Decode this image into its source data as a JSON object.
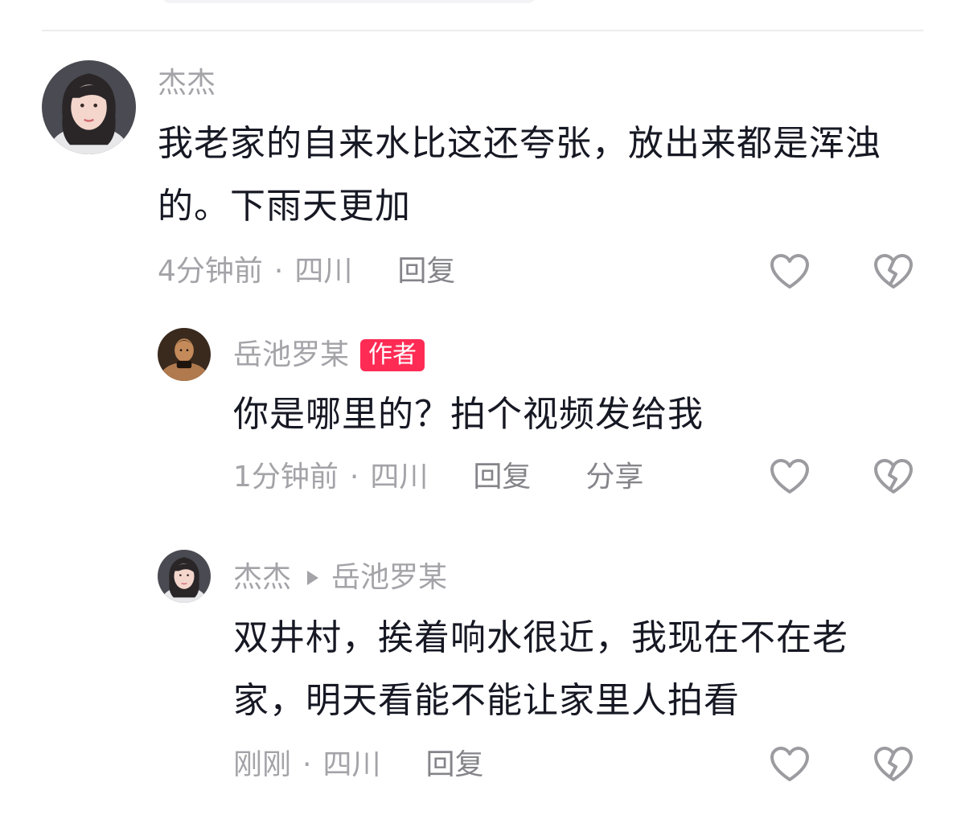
{
  "comments": [
    {
      "username": "杰杰",
      "text": "我老家的自来水比这还夸张，放出来都是浑浊的。下雨天更加",
      "time": "4分钟前",
      "separator": "·",
      "location": "四川",
      "reply_label": "回复",
      "like_icon": "heart-outline-icon",
      "dislike_icon": "broken-heart-icon"
    },
    {
      "username": "岳池罗某",
      "badge": "作者",
      "text": "你是哪里的？拍个视频发给我",
      "time": "1分钟前",
      "separator": "·",
      "location": "四川",
      "reply_label": "回复",
      "share_label": "分享",
      "like_icon": "heart-outline-icon",
      "dislike_icon": "broken-heart-icon"
    },
    {
      "username": "杰杰",
      "reply_to": "岳池罗某",
      "text": "双井村，挨着响水很近，我现在不在老家，明天看能不能让家里人拍看",
      "time": "刚刚",
      "separator": "·",
      "location": "四川",
      "reply_label": "回复",
      "like_icon": "heart-outline-icon",
      "dislike_icon": "broken-heart-icon"
    }
  ],
  "colors": {
    "badge": "#fe2c55",
    "secondary_text": "#a3a3a8",
    "primary_text": "#161823",
    "icon": "#9b9ba0"
  }
}
